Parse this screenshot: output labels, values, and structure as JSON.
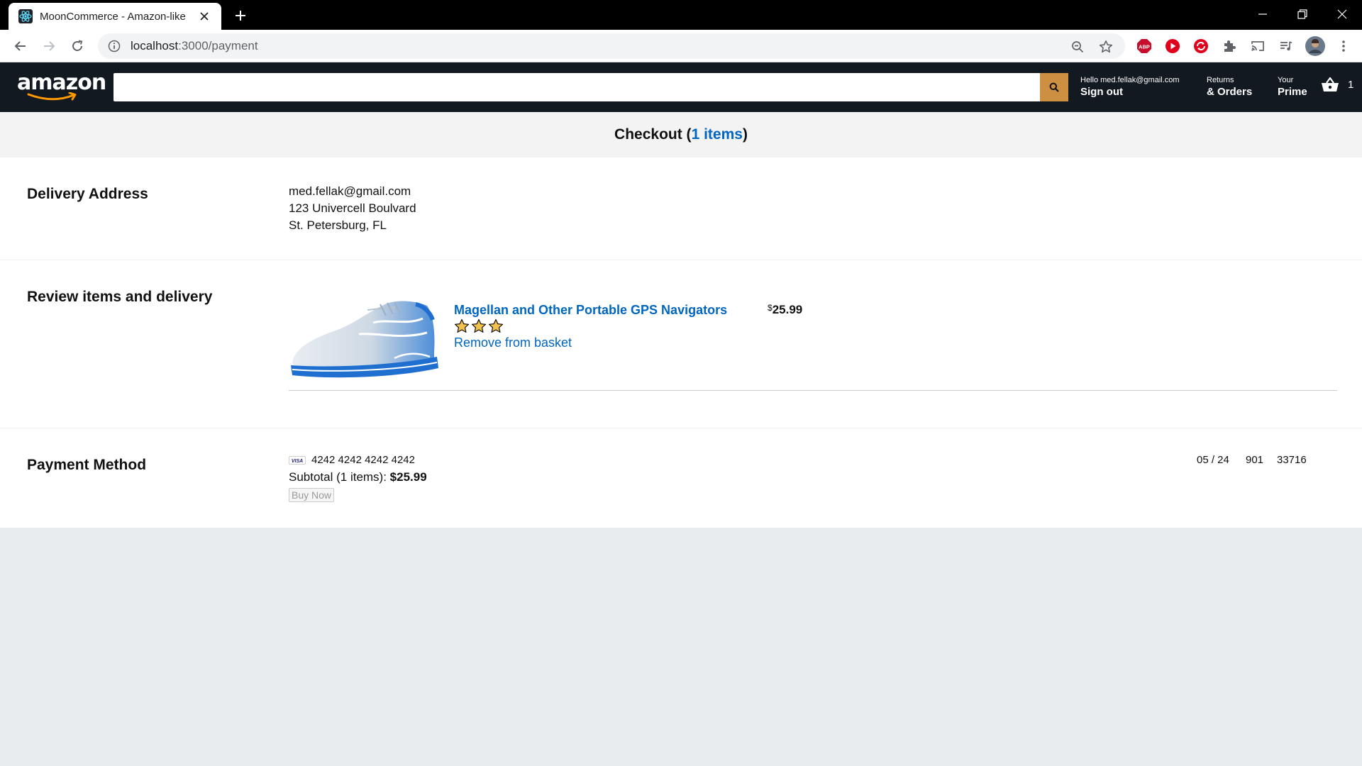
{
  "browser": {
    "tab_title": "MoonCommerce - Amazon-like",
    "url_host": "localhost",
    "url_rest": ":3000/payment"
  },
  "header": {
    "logo_text": "amazon",
    "search_placeholder": "",
    "greeting": "Hello med.fellak@gmail.com",
    "sign_out": "Sign out",
    "returns_line1": "Returns",
    "returns_line2": "& Orders",
    "prime_line1": "Your",
    "prime_line2": "Prime",
    "basket_count": "1"
  },
  "checkout": {
    "label": "Checkout (",
    "items_link": "1 items",
    "close": ")"
  },
  "delivery": {
    "title": "Delivery Address",
    "email": "med.fellak@gmail.com",
    "street": "123 Univercell Boulvard",
    "city": "St. Petersburg, FL"
  },
  "review": {
    "title": "Review items and delivery",
    "product_title": "Magellan and Other Portable GPS Navigators",
    "rating": 3,
    "remove_label": "Remove from basket",
    "price_symbol": "$",
    "price_value": "25.99"
  },
  "payment": {
    "title": "Payment Method",
    "card_brand": "VISA",
    "card_number": "4242 4242 4242 4242",
    "expiry": "05 / 24",
    "cvc": "901",
    "zip": "33716",
    "subtotal_label": "Subtotal (1 items): ",
    "subtotal_value": "$25.99",
    "buy_label": "Buy Now"
  },
  "colors": {
    "header_bg": "#131921",
    "search_button": "#cd9042",
    "link": "#0066c0",
    "star": "#f0c14b"
  }
}
